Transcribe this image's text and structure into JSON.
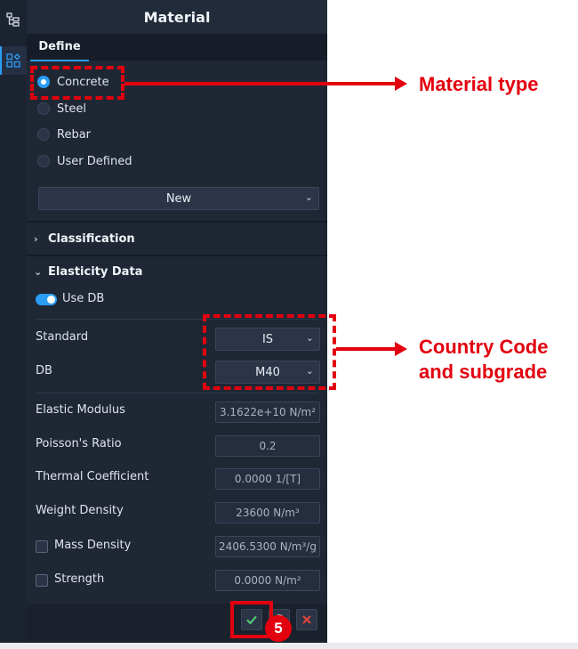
{
  "panel": {
    "title": "Material",
    "tab": "Define"
  },
  "material_types": [
    {
      "label": "Concrete",
      "checked": true
    },
    {
      "label": "Steel",
      "checked": false
    },
    {
      "label": "Rebar",
      "checked": false
    },
    {
      "label": "User Defined",
      "checked": false
    }
  ],
  "material_select": {
    "value": "New"
  },
  "sections": {
    "classification": "Classification",
    "elasticity": "Elasticity Data"
  },
  "use_db": {
    "label": "Use DB",
    "on": true
  },
  "standard": {
    "label": "Standard",
    "value": "IS"
  },
  "db": {
    "label": "DB",
    "value": "M40"
  },
  "properties": [
    {
      "label": "Elastic Modulus",
      "value": "3.1622e+10 N/m²"
    },
    {
      "label": "Poisson's Ratio",
      "value": "0.2"
    },
    {
      "label": "Thermal Coefficient",
      "value": "0.0000 1/[T]"
    },
    {
      "label": "Weight Density",
      "value": "23600 N/m³"
    },
    {
      "label": "Mass Density",
      "value": "2406.5300 N/m³/g",
      "checkbox": true
    },
    {
      "label": "Strength",
      "value": "0.0000 N/m²",
      "checkbox": true
    }
  ],
  "annotations": {
    "material_type": "Material type",
    "country_code_line1": "Country Code",
    "country_code_line2": "and subgrade",
    "step_badge": "5"
  },
  "colors": {
    "accent": "#2a9df4",
    "annotation": "#e3000f",
    "panel_bg": "#1f2735"
  }
}
